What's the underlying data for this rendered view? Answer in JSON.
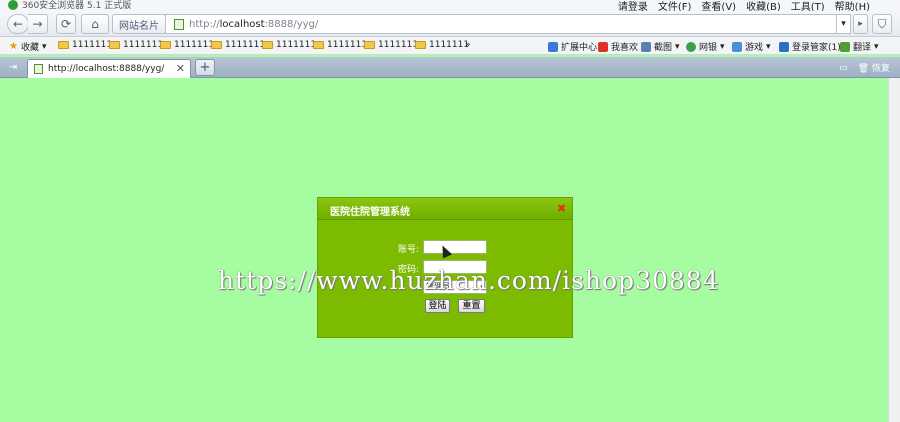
{
  "window": {
    "title": "360安全浏览器 5.1 正式版"
  },
  "menu": [
    "请登录",
    "文件(F)",
    "查看(V)",
    "收藏(B)",
    "工具(T)",
    "帮助(H)"
  ],
  "nav": {
    "back": "←",
    "forward": "→",
    "reload": "⟳",
    "home": "⌂",
    "site_name": "网站名片",
    "url_prefix": "http://",
    "url_domain": "localhost",
    "url_rest": ":8888/yyg/",
    "go": "▸",
    "dropdown": "▾"
  },
  "bookmarks": {
    "fav_label": "收藏",
    "folders": [
      "1111111",
      "1111111",
      "1111111",
      "1111111",
      "1111111",
      "1111111",
      "1111111",
      "1111111"
    ],
    "more": "»",
    "right": [
      "扩展中心",
      "我喜欢",
      "截图",
      "网银",
      "游戏",
      "登录管家(1)",
      "翻译"
    ]
  },
  "tabs": {
    "active": "http://localhost:8888/yyg/",
    "close": "✕",
    "new": "+",
    "right_label": "恢复"
  },
  "dialog": {
    "title": "医院住院管理系统",
    "close": "✖",
    "user_label": "账号:",
    "pwd_label": "密码:",
    "role_value": "管理员",
    "login": "登陆",
    "reset": "重置"
  },
  "watermark": "https://www.huzhan.com/ishop30884",
  "colors": {
    "page_bg": "#a6fca0",
    "dialog_bg": "#7cbb00"
  }
}
